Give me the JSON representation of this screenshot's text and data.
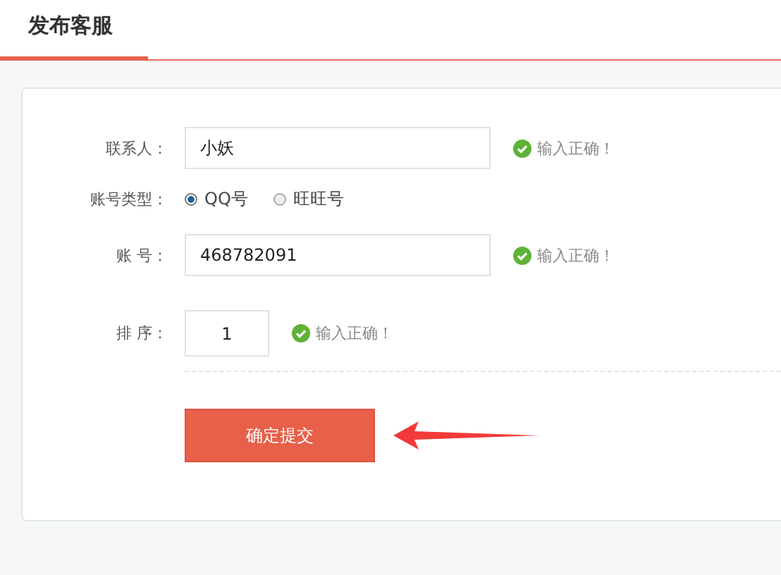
{
  "tab": {
    "label": "发布客服",
    "selected": true
  },
  "fields": [
    {
      "kind": "input",
      "label": "联系人：",
      "value": "小妖",
      "valid": true,
      "message": "输入正确！"
    },
    {
      "kind": "radio",
      "label": "账号类型：",
      "options": [
        {
          "label": "QQ号",
          "selected": true
        },
        {
          "label": "旺旺号",
          "selected": false
        }
      ]
    },
    {
      "kind": "input",
      "label": "账 号：",
      "value": "468782091",
      "valid": true,
      "message": "输入正确！"
    },
    {
      "kind": "small-input",
      "label": "排 序：",
      "value": "1",
      "valid": true,
      "message": "输入正确！"
    }
  ],
  "submit": {
    "label": "确定提交"
  }
}
